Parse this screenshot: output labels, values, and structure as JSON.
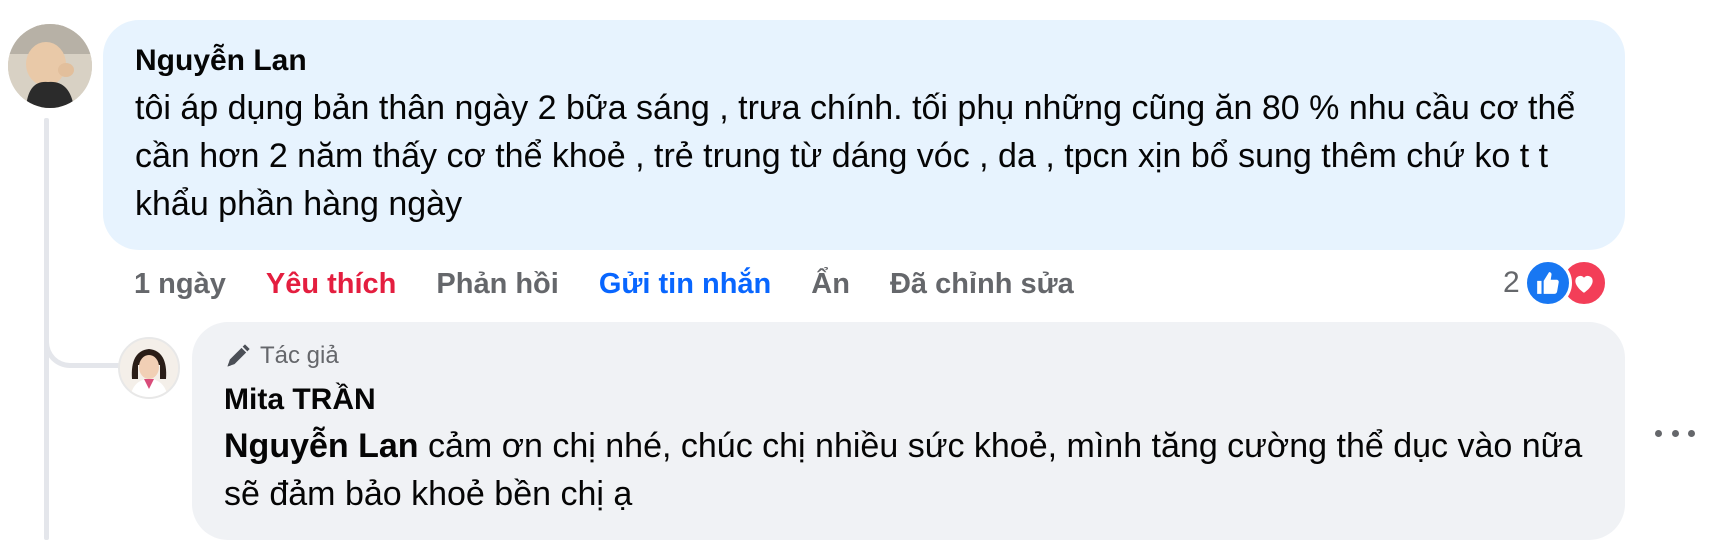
{
  "comment": {
    "author": "Nguyễn Lan",
    "text": "tôi áp dụng bản thân ngày 2 bữa sáng , trưa chính. tối phụ những cũng ăn 80 % nhu cầu cơ thể cần hơn 2 năm thấy cơ thể khoẻ , trẻ trung từ dáng vóc , da , tpcn xịn bổ sung thêm chứ ko t t khẩu phần hàng ngày",
    "actions": {
      "time": "1 ngày",
      "like": "Yêu thích",
      "reply": "Phản hồi",
      "message": "Gửi tin nhắn",
      "hide": "Ẩn",
      "edited": "Đã chỉnh sửa"
    },
    "reaction_count": "2",
    "reactions": [
      "like-icon",
      "love-icon"
    ]
  },
  "reply": {
    "badge": "Tác giả",
    "author": "Mita TRẦN",
    "mention": "Nguyễn Lan",
    "text": " cảm ơn chị nhé, chúc chị nhiều sức khoẻ, mình tăng cường thể dục vào nữa sẽ đảm bảo khoẻ bền chị ạ"
  },
  "colors": {
    "comment_bubble": "#e7f3fe",
    "reply_bubble": "#f0f2f5",
    "liked": "#e41e3f",
    "link": "#0866ff",
    "like_reaction": "#1877f2",
    "love_reaction": "#f33e58"
  }
}
